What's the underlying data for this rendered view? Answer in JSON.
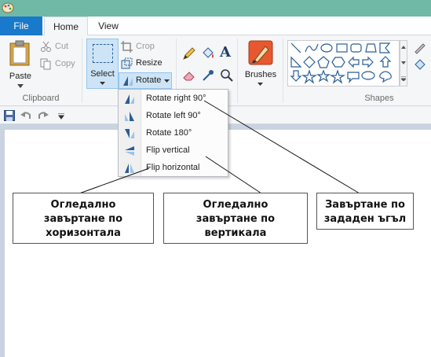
{
  "tabs": {
    "file": "File",
    "home": "Home",
    "view": "View"
  },
  "clipboard": {
    "paste": "Paste",
    "cut": "Cut",
    "copy": "Copy",
    "group_label": "Clipboard"
  },
  "image": {
    "select": "Select",
    "crop": "Crop",
    "resize": "Resize",
    "rotate": "Rotate"
  },
  "tools": {
    "brushes": "Brushes"
  },
  "shapes": {
    "group_label": "Shapes"
  },
  "rotate_menu": [
    {
      "label": "Rotate right 90°",
      "icon": "rotate-right-icon"
    },
    {
      "label": "Rotate left 90°",
      "icon": "rotate-left-icon"
    },
    {
      "label": "Rotate 180°",
      "icon": "rotate-180-icon"
    },
    {
      "label": "Flip vertical",
      "icon": "flip-vertical-icon"
    },
    {
      "label": "Flip horizontal",
      "icon": "flip-horizontal-icon"
    }
  ],
  "callouts": {
    "horizontal": "Огледално\nзавъртане по\nхоризонтала",
    "vertical": "Огледално\nзавъртане по\nвертикала",
    "angle": "Завъртане по\nзададен ъгъл"
  },
  "colors": {
    "file_tab": "#1979ca",
    "title_bar": "#6fb9a6",
    "selected": "#cde4f7"
  }
}
